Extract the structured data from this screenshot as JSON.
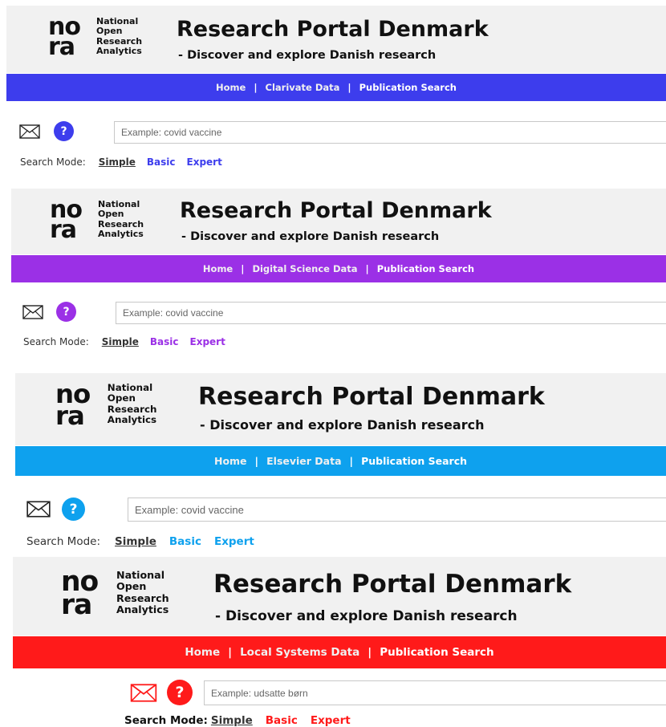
{
  "brand": {
    "logo_top": "no",
    "logo_bottom": "ra",
    "lines": [
      "National",
      "Open",
      "Research",
      "Analytics"
    ]
  },
  "title": "Research Portal Denmark",
  "subtitle": "- Discover and explore Danish research",
  "panels": [
    {
      "accent": "#3d3ded",
      "nav": [
        "Home",
        "Clarivate Data",
        "Publication Search"
      ],
      "placeholder": "Example: covid vaccine",
      "help_label": "?",
      "mode_label": "Search Mode:",
      "modes": [
        "Simple",
        "Basic",
        "Expert"
      ]
    },
    {
      "accent": "#9b30e6",
      "nav": [
        "Home",
        "Digital Science Data",
        "Publication Search"
      ],
      "placeholder": "Example: covid vaccine",
      "help_label": "?",
      "mode_label": "Search Mode:",
      "modes": [
        "Simple",
        "Basic",
        "Expert"
      ]
    },
    {
      "accent": "#0ea1ee",
      "nav": [
        "Home",
        "Elsevier Data",
        "Publication Search"
      ],
      "placeholder": "Example: covid vaccine",
      "help_label": "?",
      "mode_label": "Search Mode:",
      "modes": [
        "Simple",
        "Basic",
        "Expert"
      ]
    },
    {
      "accent": "#ff1a1a",
      "nav": [
        "Home",
        "Local Systems Data",
        "Publication Search"
      ],
      "placeholder": "Example: udsatte børn",
      "help_label": "?",
      "mode_label": "Search Mode:",
      "modes": [
        "Simple",
        "Basic",
        "Expert"
      ]
    }
  ]
}
